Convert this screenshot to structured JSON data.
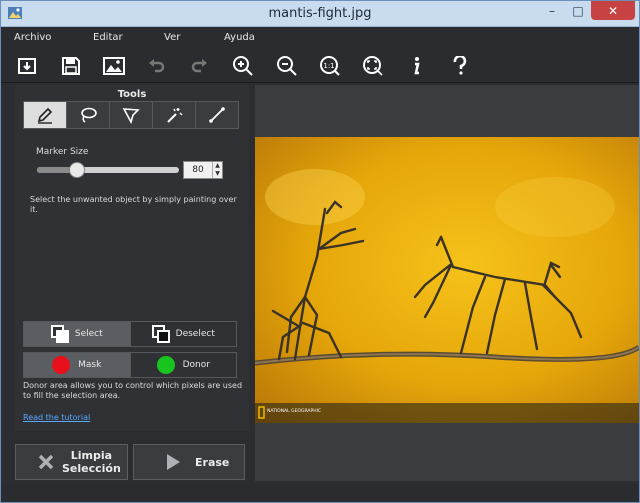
{
  "window": {
    "title": "mantis-fight.jpg",
    "controls": [
      "–",
      "□",
      "✕"
    ]
  },
  "menu": {
    "items": [
      "Archivo",
      "Editar",
      "Ver",
      "Ayuda"
    ]
  },
  "toolbar": {
    "icons": [
      "open-icon",
      "save-icon",
      "image-icon",
      "undo-icon",
      "redo-icon",
      "zoom-in-icon",
      "zoom-out-icon",
      "actual-size-icon",
      "fit-window-icon",
      "info-icon",
      "help-icon"
    ]
  },
  "tools_panel": {
    "title": "Tools",
    "tools": [
      "marker-icon",
      "lasso-icon",
      "polygon-lasso-icon",
      "magic-wand-icon",
      "line-icon"
    ],
    "active_tool": 0,
    "marker_size_label": "Marker Size",
    "marker_size_value": "80",
    "marker_size_fraction": 0.28,
    "hint": "Select the unwanted object by simply painting over it.",
    "select_label": "Select",
    "deselect_label": "Deselect",
    "mask_label": "Mask",
    "donor_label": "Donor",
    "mask_color": "#e8101a",
    "donor_color": "#19c41f",
    "donor_hint": "Donor area allows you to control which pixels are used to fill the selection area.",
    "tutorial_link": "Read the tutorial"
  },
  "actions": {
    "clear_line1": "Limpia",
    "clear_line2": "Selección",
    "erase_label": "Erase"
  },
  "photo": {
    "watermark": "NATIONAL GEOGRAPHIC",
    "brand_color": "#f2c200"
  }
}
